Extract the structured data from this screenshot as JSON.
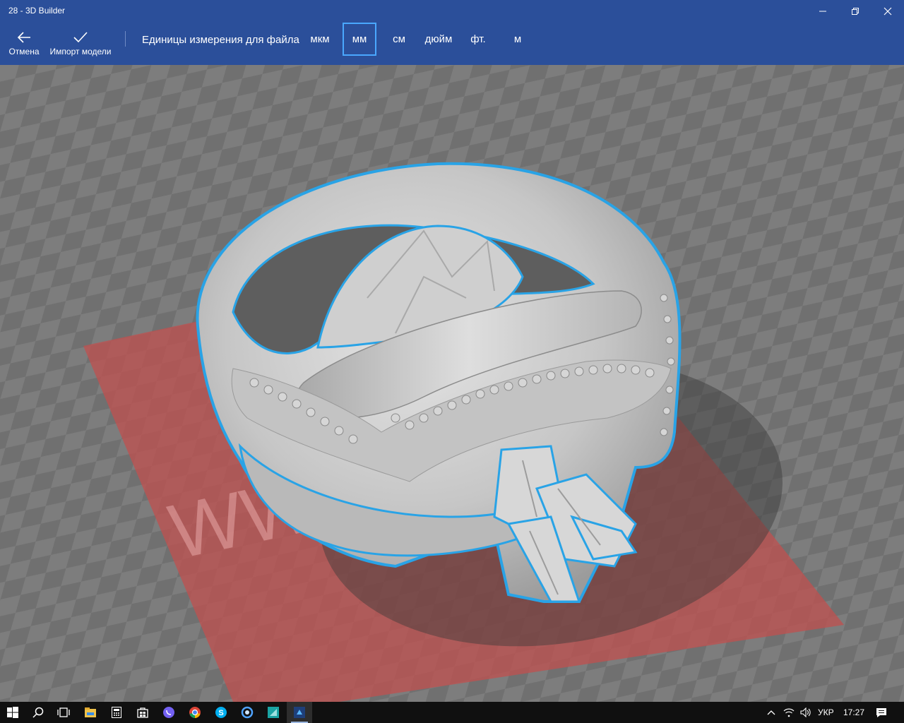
{
  "window": {
    "title": "28 - 3D Builder",
    "controls": [
      "minimize-icon",
      "restore-icon",
      "close-icon"
    ]
  },
  "commands": {
    "cancel_label": "Отмена",
    "import_label": "Импорт модели"
  },
  "units": {
    "label": "Единицы измерения для файла",
    "options": [
      "мкм",
      "мм",
      "см",
      "дюйм",
      "фт.",
      "м"
    ],
    "selected": "мм"
  },
  "viewport": {
    "watermark": "WW",
    "colors": {
      "plate": "#c0504f",
      "outline": "#29a3e6",
      "model": "#c9c9c9"
    }
  },
  "taskbar": {
    "apps": [
      "start-icon",
      "search-icon",
      "task-view-icon",
      "file-explorer-icon",
      "calculator-icon",
      "store-icon",
      "viber-icon",
      "chrome-icon",
      "skype-icon",
      "cortana-icon",
      "app-icon",
      "3d-builder-icon"
    ],
    "language": "УКР",
    "time": "17:27"
  }
}
